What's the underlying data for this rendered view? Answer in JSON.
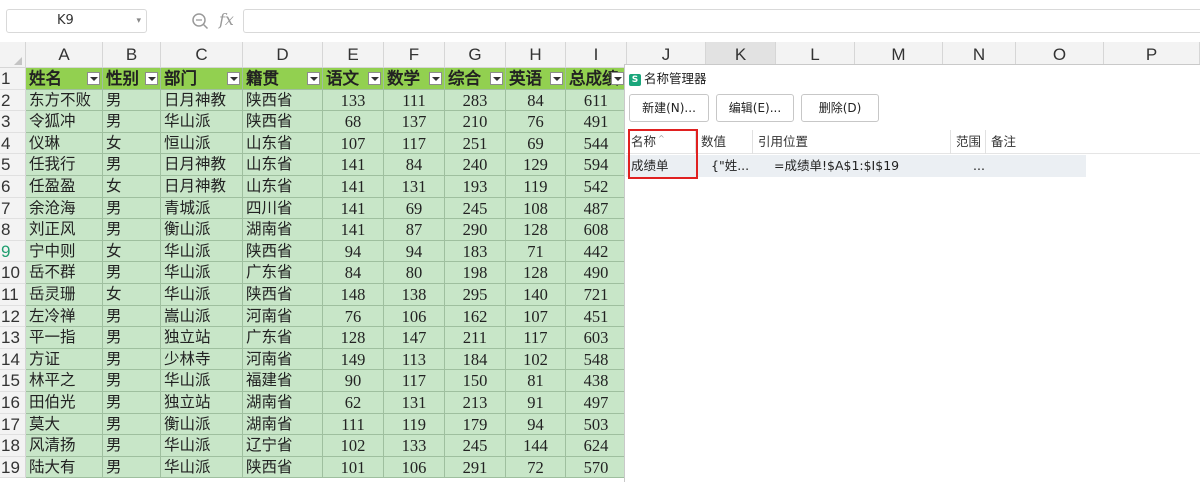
{
  "formula_bar": {
    "name_box": "K9",
    "fx_label": "fx",
    "formula": ""
  },
  "columns": [
    "A",
    "B",
    "C",
    "D",
    "E",
    "F",
    "G",
    "H",
    "I",
    "J",
    "K",
    "L",
    "M",
    "N",
    "O",
    "P"
  ],
  "active_column": "K",
  "active_row": "9",
  "table": {
    "headers": [
      "姓名",
      "性别",
      "部门",
      "籍贯",
      "语文",
      "数学",
      "综合",
      "英语",
      "总成绩"
    ],
    "rows": [
      [
        "东方不败",
        "男",
        "日月神教",
        "陕西省",
        "133",
        "111",
        "283",
        "84",
        "611"
      ],
      [
        "令狐冲",
        "男",
        "华山派",
        "陕西省",
        "68",
        "137",
        "210",
        "76",
        "491"
      ],
      [
        "仪琳",
        "女",
        "恒山派",
        "山东省",
        "107",
        "117",
        "251",
        "69",
        "544"
      ],
      [
        "任我行",
        "男",
        "日月神教",
        "山东省",
        "141",
        "84",
        "240",
        "129",
        "594"
      ],
      [
        "任盈盈",
        "女",
        "日月神教",
        "山东省",
        "141",
        "131",
        "193",
        "119",
        "542"
      ],
      [
        "余沧海",
        "男",
        "青城派",
        "四川省",
        "141",
        "69",
        "245",
        "108",
        "487"
      ],
      [
        "刘正风",
        "男",
        "衡山派",
        "湖南省",
        "141",
        "87",
        "290",
        "128",
        "608"
      ],
      [
        "宁中则",
        "女",
        "华山派",
        "陕西省",
        "94",
        "94",
        "183",
        "71",
        "442"
      ],
      [
        "岳不群",
        "男",
        "华山派",
        "广东省",
        "84",
        "80",
        "198",
        "128",
        "490"
      ],
      [
        "岳灵珊",
        "女",
        "华山派",
        "陕西省",
        "148",
        "138",
        "295",
        "140",
        "721"
      ],
      [
        "左冷禅",
        "男",
        "嵩山派",
        "河南省",
        "76",
        "106",
        "162",
        "107",
        "451"
      ],
      [
        "平一指",
        "男",
        "独立站",
        "广东省",
        "128",
        "147",
        "211",
        "117",
        "603"
      ],
      [
        "方证",
        "男",
        "少林寺",
        "河南省",
        "149",
        "113",
        "184",
        "102",
        "548"
      ],
      [
        "林平之",
        "男",
        "华山派",
        "福建省",
        "90",
        "117",
        "150",
        "81",
        "438"
      ],
      [
        "田伯光",
        "男",
        "独立站",
        "湖南省",
        "62",
        "131",
        "213",
        "91",
        "497"
      ],
      [
        "莫大",
        "男",
        "衡山派",
        "湖南省",
        "111",
        "119",
        "179",
        "94",
        "503"
      ],
      [
        "风清扬",
        "男",
        "华山派",
        "辽宁省",
        "102",
        "133",
        "245",
        "144",
        "624"
      ],
      [
        "陆大有",
        "男",
        "华山派",
        "陕西省",
        "101",
        "106",
        "291",
        "72",
        "570"
      ]
    ]
  },
  "dialog": {
    "title": "名称管理器",
    "icon_letter": "S",
    "buttons": {
      "new": "新建(N)...",
      "edit": "编辑(E)...",
      "delete": "删除(D)"
    },
    "list_headers": {
      "name": "名称",
      "value": "数值",
      "refers_to": "引用位置",
      "scope": "范围",
      "comment": "备注"
    },
    "entry": {
      "name": "成绩单",
      "value": "{\"姓...",
      "refers_to": "=成绩单!$A$1:$I$19",
      "scope": "..."
    }
  },
  "colors": {
    "header_fill": "#92d050",
    "data_fill": "#c8e6c8",
    "highlight": "#e02020",
    "accent": "#1aa67b"
  }
}
